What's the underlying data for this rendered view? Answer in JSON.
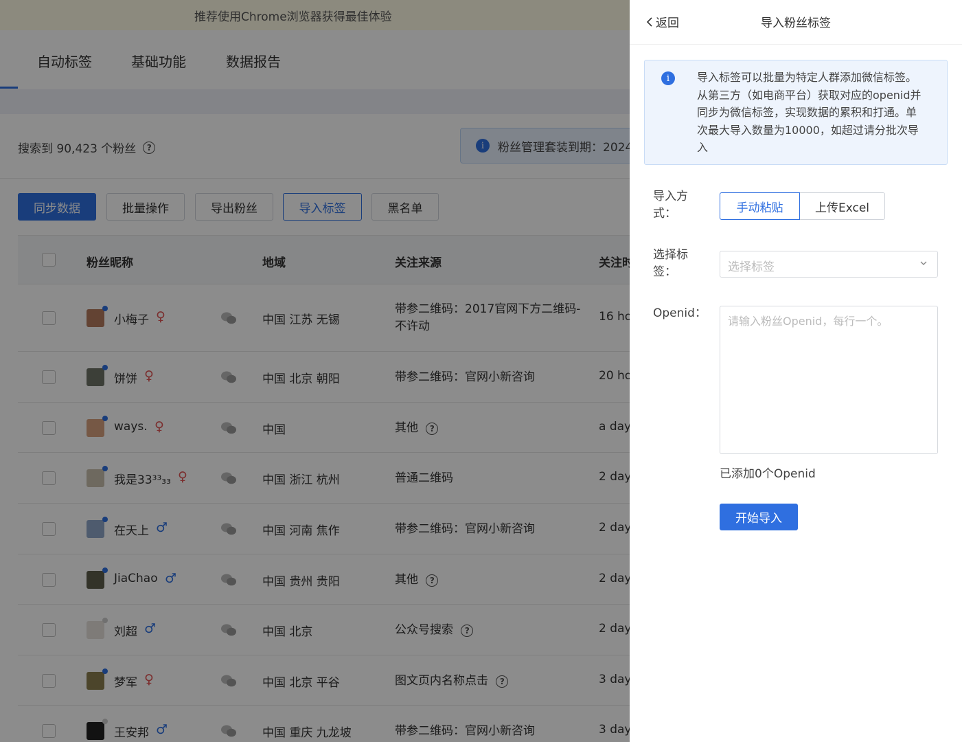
{
  "banner": {
    "text": "推荐使用Chrome浏览器获得最佳体验"
  },
  "nav": {
    "tabs": [
      "自动标签",
      "基础功能",
      "数据报告"
    ]
  },
  "summary": {
    "text": "搜索到 90,423 个粉丝",
    "help_icon": "question-circle-icon"
  },
  "notice": {
    "icon": "info-icon",
    "text": "粉丝管理套装到期：2024"
  },
  "toolbar": {
    "sync": "同步数据",
    "batch": "批量操作",
    "export": "导出粉丝",
    "import_tags": "导入标签",
    "blacklist": "黑名单"
  },
  "table": {
    "headers": {
      "nickname": "粉丝昵称",
      "region": "地域",
      "source": "关注来源",
      "time": "关注时"
    },
    "rows": [
      {
        "name": "小梅子",
        "gender": "♀",
        "region": "中国 江苏 无锡",
        "source_line1": "带参二维码：2017官网下方二维码-",
        "source_line2": "不许动",
        "time": "16 ho",
        "help": false,
        "online": true
      },
      {
        "name": "饼饼",
        "gender": "♀",
        "region": "中国 北京 朝阳",
        "source_line1": "带参二维码：官网小新咨询",
        "source_line2": "",
        "time": "20 ho",
        "help": false,
        "online": true
      },
      {
        "name": "ways.",
        "gender": "♀",
        "region": "中国",
        "source_line1": "其他",
        "source_line2": "",
        "time": "a day",
        "help": true,
        "online": true
      },
      {
        "name": "我是33³³₃₃",
        "gender": "♀",
        "region": "中国 浙江 杭州",
        "source_line1": "普通二维码",
        "source_line2": "",
        "time": "2 days",
        "help": false,
        "online": true
      },
      {
        "name": "在天上",
        "gender": "♂",
        "region": "中国 河南 焦作",
        "source_line1": "带参二维码：官网小新咨询",
        "source_line2": "",
        "time": "2 days",
        "help": false,
        "online": true
      },
      {
        "name": "JiaChao",
        "gender": "♂",
        "region": "中国 贵州 贵阳",
        "source_line1": "其他",
        "source_line2": "",
        "time": "2 days",
        "help": true,
        "online": true
      },
      {
        "name": "刘超",
        "gender": "♂",
        "region": "中国 北京",
        "source_line1": "公众号搜索",
        "source_line2": "",
        "time": "2 days",
        "help": true,
        "online": false
      },
      {
        "name": "梦军",
        "gender": "♀",
        "region": "中国 北京 平谷",
        "source_line1": "图文页内名称点击",
        "source_line2": "",
        "time": "3 days",
        "help": true,
        "online": true
      },
      {
        "name": "王安邦",
        "gender": "♂",
        "region": "中国 重庆 九龙坡",
        "source_line1": "带参二维码：官网小新咨询",
        "source_line2": "",
        "time": "3 days",
        "help": false,
        "online": false
      }
    ]
  },
  "drawer": {
    "back": "返回",
    "title": "导入粉丝标签",
    "tip": "导入标签可以批量为特定人群添加微信标签。从第三方（如电商平台）获取对应的openid并同步为微信标签，实现数据的累积和打通。单次最大导入数量为10000，如超过请分批次导入",
    "method_label": "导入方式：",
    "method_options": [
      "手动粘贴",
      "上传Excel"
    ],
    "tag_label": "选择标签：",
    "tag_placeholder": "选择标签",
    "openid_label": "Openid：",
    "openid_placeholder": "请输入粉丝Openid，每行一个。",
    "count_text": "已添加0个Openid",
    "start_button": "开始导入"
  },
  "colors": {
    "primary": "#2f6fe0",
    "female": "#e05555",
    "male": "#2f6fe0"
  }
}
